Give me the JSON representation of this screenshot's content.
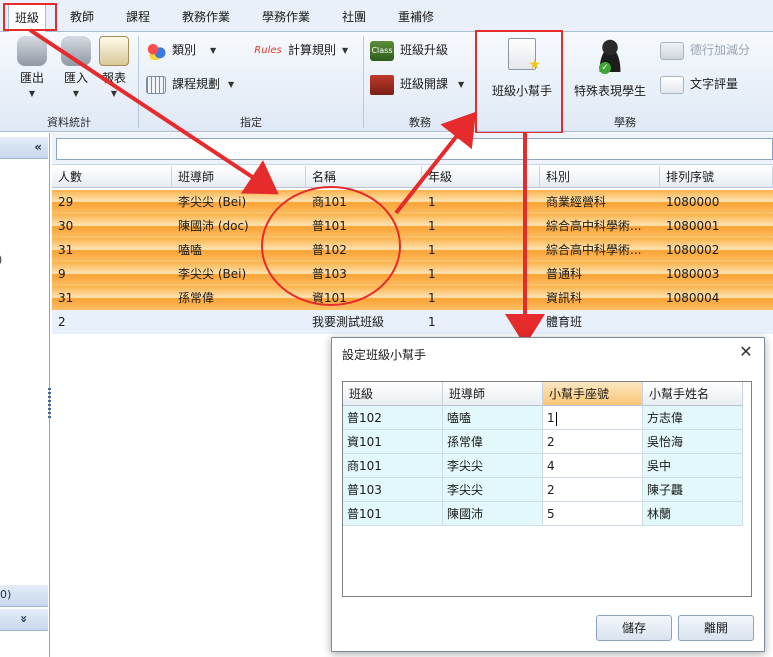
{
  "ribbon_tabs": [
    "班級",
    "教師",
    "課程",
    "教務作業",
    "學務作業",
    "社團",
    "重補修"
  ],
  "ribbon": {
    "group_stats": {
      "label": "資料統計",
      "buttons": [
        "匯出",
        "匯入",
        "報表"
      ]
    },
    "group_assign": {
      "label": "指定",
      "items": [
        "類別",
        "課程規劃",
        "計算規則"
      ],
      "rules_icon_text": "Rules"
    },
    "group_academic": {
      "label": "教務",
      "items": [
        "班級升級",
        "班級開課"
      ],
      "class_icon_text": "Class"
    },
    "group_student": {
      "label": "學務",
      "big_buttons": [
        "班級小幫手",
        "特殊表現學生"
      ],
      "items": [
        "德行加減分",
        "文字評量"
      ]
    }
  },
  "left_panel": {
    "collapse_icon": "«",
    "expand_icon": "»",
    "partial_texts": [
      ")",
      "0)"
    ]
  },
  "grid": {
    "columns": [
      "人數",
      "班導師",
      "名稱",
      "年級",
      "科別",
      "排列序號"
    ],
    "rows": [
      [
        "29",
        "李尖尖 (Bei)",
        "商101",
        "1",
        "商業經營科",
        "1080000"
      ],
      [
        "30",
        "陳國沛 (doc)",
        "普101",
        "1",
        "綜合高中科學術...",
        "1080001"
      ],
      [
        "31",
        "嗑嗑",
        "普102",
        "1",
        "綜合高中科學術...",
        "1080002"
      ],
      [
        "9",
        "李尖尖 (Bei)",
        "普103",
        "1",
        "普通科",
        "1080003"
      ],
      [
        "31",
        "孫常偉",
        "資101",
        "1",
        "資訊科",
        "1080004"
      ],
      [
        "2",
        "",
        "我要測試班級",
        "1",
        "體育班",
        ""
      ]
    ]
  },
  "dialog": {
    "title": "設定班級小幫手",
    "close_label": "✕",
    "columns": [
      "班級",
      "班導師",
      "小幫手座號",
      "小幫手姓名"
    ],
    "rows": [
      [
        "普102",
        "嗑嗑",
        "1",
        "方志偉"
      ],
      [
        "資101",
        "孫常偉",
        "2",
        "吳怡海"
      ],
      [
        "商101",
        "李尖尖",
        "4",
        "吳中"
      ],
      [
        "普103",
        "李尖尖",
        "2",
        "陳子龘"
      ],
      [
        "普101",
        "陳國沛",
        "5",
        "林蘭"
      ]
    ],
    "save_label": "儲存",
    "exit_label": "離開"
  },
  "colors": {
    "highlight": "#e52b2b",
    "row_orange": "#fbb24a",
    "dialog_cell": "#e2f8fa"
  }
}
